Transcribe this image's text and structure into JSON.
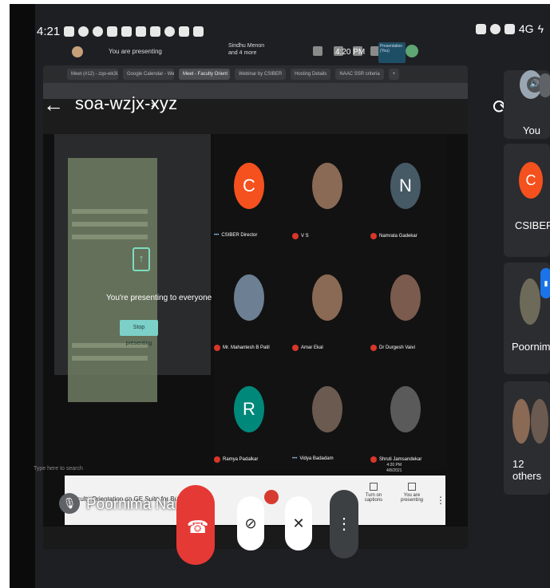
{
  "status_bar": {
    "time": "4:21",
    "icons": [
      "notification-icon",
      "whatsapp-icon",
      "record-icon",
      "gallery-icon",
      "accessibility-icon",
      "mic-icon",
      "mail-icon",
      "check-icon",
      "doc-icon",
      "battery-saver-icon"
    ],
    "right_icons": [
      "nfc-icon",
      "hotspot-icon",
      "sim-icon",
      "signal-icon",
      "charging-icon"
    ],
    "signal_label": "4G"
  },
  "meeting": {
    "title": "soa-wzjx-xyz",
    "title_chevron": "›",
    "back_glyph": "←"
  },
  "shared_screen": {
    "browser_tabs": [
      "Meet (#12) - zqo-wk3UN",
      "Google Calendar - Week",
      "Meet - Faculty Orient",
      "Webinar by CSIBER",
      "Hosting Details",
      "NAAC SSR criteria",
      "+"
    ],
    "you_presenting": "You are presenting",
    "others_names": "Sindhu Menon and 4 more",
    "clock": "4:20 PM",
    "presentation_chip": "Presentation (You)",
    "presenting_message": "You're presenting to everyone",
    "stop_presenting": "Stop presenting",
    "taskbar_search": "Type here to search",
    "taskbar_time": "4:20 PM",
    "taskbar_date": "4/8/2021",
    "participants": [
      {
        "name": "CSIBER Director",
        "initial": "C",
        "color": "#f4511e",
        "indicator": "dots"
      },
      {
        "name": "V S",
        "initial": "",
        "color": "#8a6a55",
        "indicator": "muted"
      },
      {
        "name": "Namrata Gadekar",
        "initial": "N",
        "color": "#455a64",
        "indicator": "muted"
      },
      {
        "name": "Mr. Mahantesh B Patil",
        "initial": "",
        "color": "#6d7f93",
        "indicator": "muted"
      },
      {
        "name": "Amar Ekal",
        "initial": "",
        "color": "#8a6a55",
        "indicator": "muted"
      },
      {
        "name": "Dr Durgesh Vaivi",
        "initial": "",
        "color": "#7b5b4d",
        "indicator": "muted"
      },
      {
        "name": "Ramya Padalkar",
        "initial": "R",
        "color": "#00897b",
        "indicator": "muted"
      },
      {
        "name": "Vidya Badadam",
        "initial": "",
        "color": "#6b5a4f",
        "indicator": "dots"
      },
      {
        "name": "Shruti Jamsandekar",
        "initial": "",
        "color": "#5a5a5a",
        "indicator": "muted"
      }
    ]
  },
  "bottom_bar": {
    "caption": "Faculty Orientation on GE Suite for Business",
    "captions_label": "Turn on captions",
    "presenting_label": "You are presenting",
    "more_glyph": "⋮"
  },
  "self": {
    "name": "Poornima Naik",
    "mic_off_glyph": "🎙"
  },
  "controls": {
    "end_call_glyph": "☎",
    "camera_glyph": "⊘",
    "mic_glyph": "✕",
    "more_glyph": "⋮"
  },
  "right_panel": {
    "rotate_glyph": "⟳",
    "you_label": "You",
    "sound_glyph": "🔊",
    "csiber_initial": "C",
    "csiber_color": "#f4511e",
    "csiber_label": "CSIBER",
    "poornima_label": "Poornima",
    "others_label": "12 others"
  }
}
